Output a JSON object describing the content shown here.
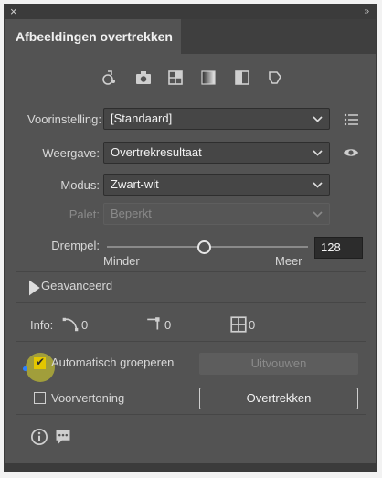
{
  "window": {
    "close_icon": "×",
    "grip_icon": "»"
  },
  "panel": {
    "tab_title": "Afbeeldingen overtrekken"
  },
  "presets_icons": [
    "auto-color-icon",
    "camera-icon",
    "grid-icon",
    "gradient-icon",
    "half-square-icon",
    "shape-icon"
  ],
  "fields": {
    "preset": {
      "label": "Voorinstelling:",
      "value": "[Standaard]"
    },
    "view": {
      "label": "Weergave:",
      "value": "Overtrekresultaat"
    },
    "mode": {
      "label": "Modus:",
      "value": "Zwart-wit"
    },
    "palette": {
      "label": "Palet:",
      "value": "Beperkt"
    },
    "threshold": {
      "label": "Drempel:",
      "value": "128",
      "min_label": "Minder",
      "max_label": "Meer",
      "fraction": 0.49
    }
  },
  "advanced": {
    "label": "Geavanceerd"
  },
  "info": {
    "label": "Info:",
    "paths": "0",
    "anchors": "0",
    "colors": "0"
  },
  "options": {
    "auto_group": {
      "label": "Automatisch groeperen",
      "checked": true
    },
    "preview": {
      "label": "Voorvertoning",
      "checked": false
    }
  },
  "buttons": {
    "expand": "Uitvouwen",
    "trace": "Overtrekken"
  },
  "chevron": "⌄"
}
